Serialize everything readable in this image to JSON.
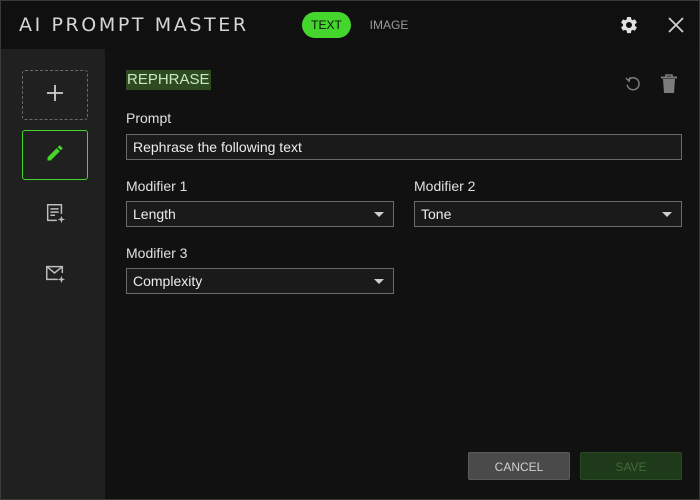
{
  "app": {
    "title": "AI PROMPT MASTER"
  },
  "tabs": [
    {
      "label": "TEXT",
      "active": true
    },
    {
      "label": "IMAGE",
      "active": false
    }
  ],
  "colors": {
    "accent": "#44d62c",
    "background": "#111111",
    "sidebar": "#202020"
  },
  "header_icons": [
    "gear-icon",
    "close-icon"
  ],
  "sidebar": {
    "items": [
      {
        "icon": "plus-icon",
        "kind": "add"
      },
      {
        "icon": "pencil-icon",
        "kind": "rephrase",
        "active": true
      },
      {
        "icon": "summarize-icon",
        "kind": "summarize"
      },
      {
        "icon": "email-icon",
        "kind": "email"
      }
    ]
  },
  "editor": {
    "heading": "REPHRASE",
    "prompt_label": "Prompt",
    "prompt_value": "Rephrase the following text",
    "modifier1_label": "Modifier 1",
    "modifier1_value": "Length",
    "modifier2_label": "Modifier 2",
    "modifier2_value": "Tone",
    "modifier3_label": "Modifier 3",
    "modifier3_value": "Complexity"
  },
  "footer": {
    "cancel_label": "CANCEL",
    "save_label": "SAVE"
  }
}
